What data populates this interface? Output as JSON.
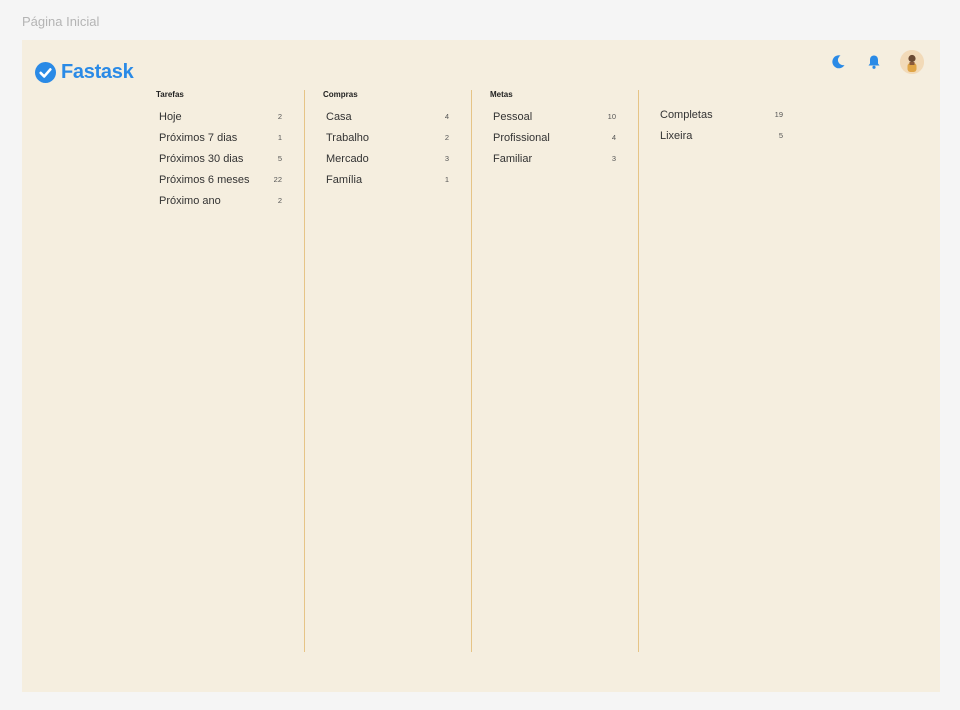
{
  "frame": {
    "title": "Página Inicial"
  },
  "brand": {
    "name": "Fastask",
    "color": "#2a8ae6"
  },
  "header": {
    "icons": [
      "moon-icon",
      "bell-icon",
      "avatar"
    ]
  },
  "columns": [
    {
      "title": "Tarefas",
      "items": [
        {
          "label": "Hoje",
          "count": "2"
        },
        {
          "label": "Próximos 7 dias",
          "count": "1"
        },
        {
          "label": "Próximos 30 dias",
          "count": "5"
        },
        {
          "label": "Próximos 6 meses",
          "count": "22"
        },
        {
          "label": "Próximo ano",
          "count": "2"
        }
      ]
    },
    {
      "title": "Compras",
      "items": [
        {
          "label": "Casa",
          "count": "4"
        },
        {
          "label": "Trabalho",
          "count": "2"
        },
        {
          "label": "Mercado",
          "count": "3"
        },
        {
          "label": "Família",
          "count": "1"
        }
      ]
    },
    {
      "title": "Metas",
      "items": [
        {
          "label": "Pessoal",
          "count": "10"
        },
        {
          "label": "Profissional",
          "count": "4"
        },
        {
          "label": "Familiar",
          "count": "3"
        }
      ]
    },
    {
      "title": "",
      "items": [
        {
          "label": "Completas",
          "count": "19"
        },
        {
          "label": "Lixeira",
          "count": "5"
        }
      ]
    }
  ],
  "colors": {
    "app_bg": "#f5eedf",
    "divider": "#e6c486",
    "accent": "#2a8ae6"
  }
}
